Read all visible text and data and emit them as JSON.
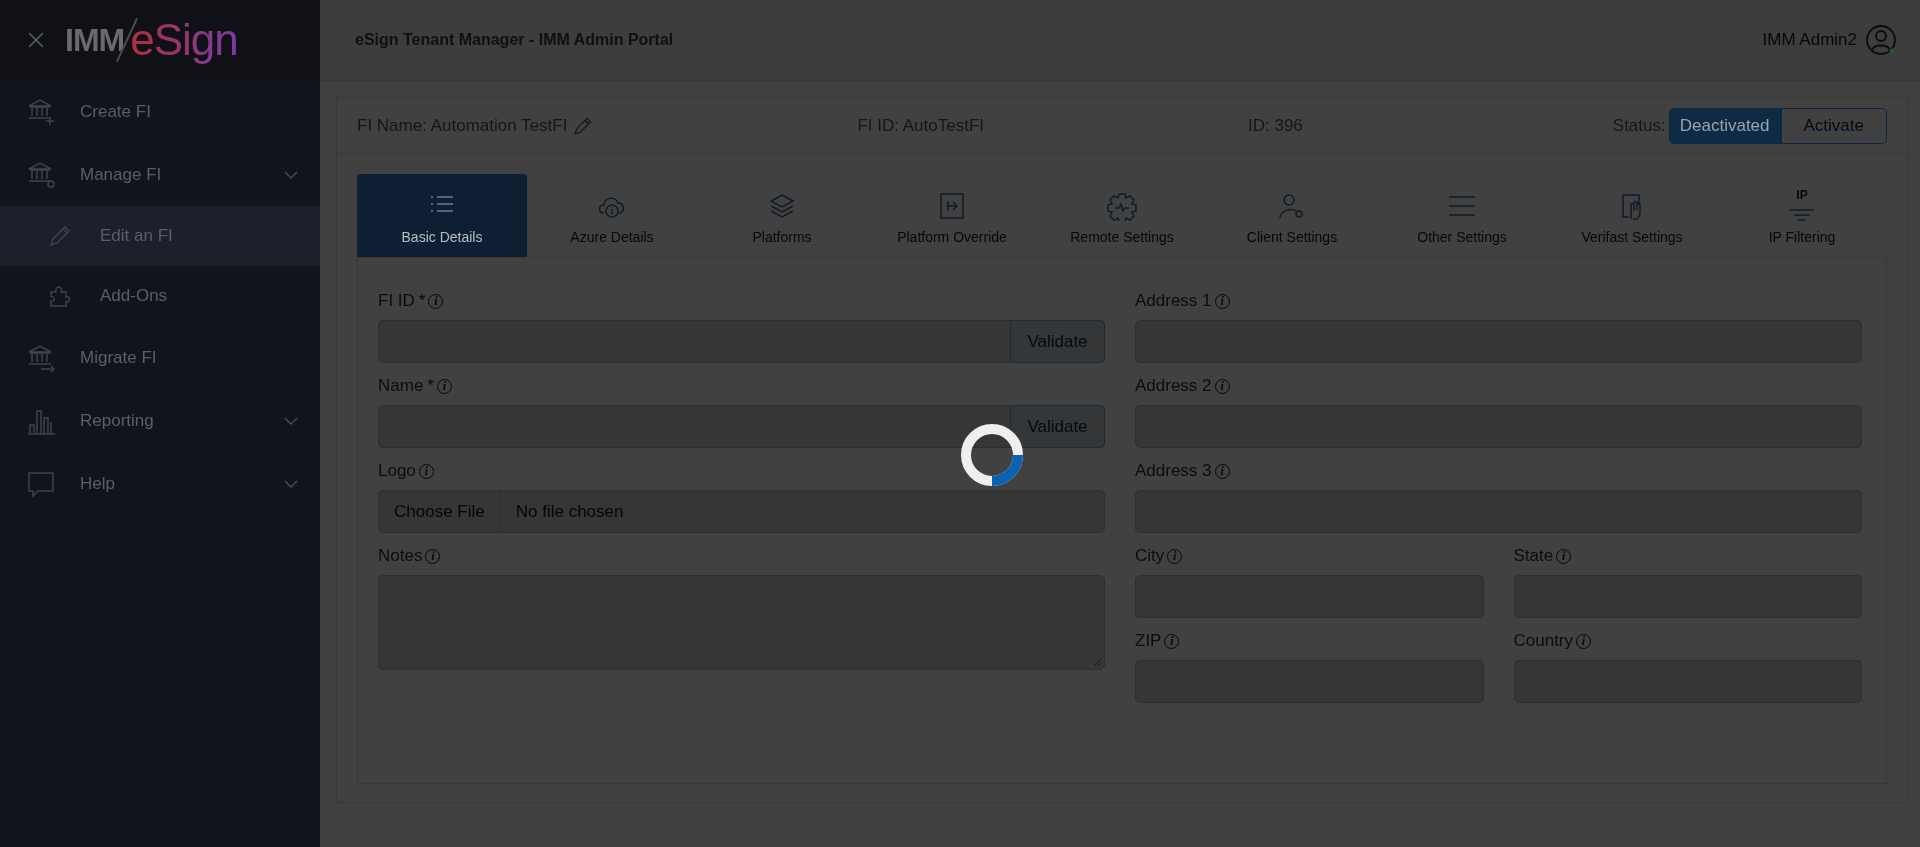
{
  "sidebar": {
    "logo": {
      "part_1": "IMM",
      "part_2": "eSign"
    },
    "items": [
      {
        "label": "Create FI",
        "kind": "link"
      },
      {
        "label": "Manage FI",
        "kind": "group",
        "children": [
          {
            "label": "Edit an FI",
            "selected": true
          },
          {
            "label": "Add-Ons",
            "selected": false
          }
        ]
      },
      {
        "label": "Migrate FI",
        "kind": "link"
      },
      {
        "label": "Reporting",
        "kind": "group"
      },
      {
        "label": "Help",
        "kind": "group"
      }
    ]
  },
  "header": {
    "title": "eSign Tenant Manager - IMM Admin Portal",
    "user": "IMM Admin2"
  },
  "fi_bar": {
    "name": "FI Name: Automation TestFI",
    "fi_id": "FI ID: AutoTestFI",
    "id": "ID: 396",
    "status_label": "Status:",
    "status_options": [
      {
        "label": "Deactivated",
        "selected": true
      },
      {
        "label": "Activate",
        "selected": false
      }
    ]
  },
  "tabs": [
    {
      "label": "Basic Details",
      "selected": true
    },
    {
      "label": "Azure Details",
      "selected": false
    },
    {
      "label": "Platforms",
      "selected": false
    },
    {
      "label": "Platform Override",
      "selected": false
    },
    {
      "label": "Remote Settings",
      "selected": false
    },
    {
      "label": "Client Settings",
      "selected": false
    },
    {
      "label": "Other Settings",
      "selected": false
    },
    {
      "label": "Verifast Settings",
      "selected": false
    },
    {
      "label": "IP Filtering",
      "selected": false,
      "icon_text": "IP"
    }
  ],
  "form": {
    "left": [
      {
        "label": "FI ID",
        "required_mark": "*",
        "info": "i",
        "kind": "validate",
        "button": "Validate"
      },
      {
        "label": "Name",
        "required_mark": "*",
        "info": "i",
        "kind": "validate",
        "button": "Validate"
      },
      {
        "label": "Logo",
        "info": "i",
        "kind": "file",
        "button": "Choose File",
        "value": "No file chosen"
      },
      {
        "label": "Notes",
        "info": "i",
        "kind": "textarea"
      }
    ],
    "right": [
      {
        "label": "Address 1",
        "info": "i",
        "kind": "full"
      },
      {
        "label": "Address 2",
        "info": "i",
        "kind": "full"
      },
      {
        "label": "Address 3",
        "info": "i",
        "kind": "full"
      },
      {
        "label": "City",
        "info": "i",
        "kind": "half"
      },
      {
        "label": "State",
        "info": "i",
        "kind": "half"
      },
      {
        "label": "ZIP",
        "info": "i",
        "kind": "half"
      },
      {
        "label": "Country",
        "info": "i",
        "kind": "half"
      }
    ]
  }
}
